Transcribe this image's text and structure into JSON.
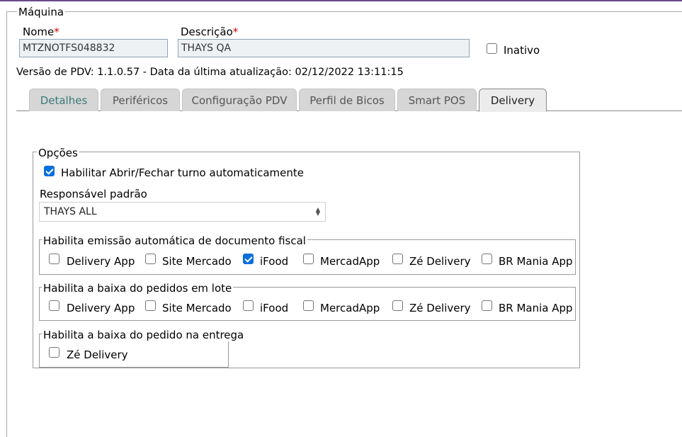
{
  "machine": {
    "legend": "Máquina",
    "nome": {
      "label": "Nome",
      "value": "MTZNOTFS048832"
    },
    "descricao": {
      "label": "Descrição",
      "value": "THAYS QA"
    },
    "inativo_label": "Inativo",
    "version_info": "Versão de PDV: 1.1.0.57 - Data da última atualização: 02/12/2022 13:11:15"
  },
  "tabs": [
    "Detalhes",
    "Periféricos",
    "Configuração PDV",
    "Perfil de Bicos",
    "Smart POS",
    "Delivery"
  ],
  "active_tab": "Delivery",
  "opcoes": {
    "legend": "Opções",
    "auto_turno_label": "Habilitar Abrir/Fechar turno automaticamente",
    "auto_turno_checked": true,
    "responsavel_label": "Responsável padrão",
    "responsavel_value": "THAYS ALL"
  },
  "emissao": {
    "legend": "Habilita emissão automática de documento fiscal",
    "items": [
      {
        "label": "Delivery App",
        "checked": false
      },
      {
        "label": "Site Mercado",
        "checked": false
      },
      {
        "label": "iFood",
        "checked": true
      },
      {
        "label": "MercadApp",
        "checked": false
      },
      {
        "label": "Zé Delivery",
        "checked": false
      },
      {
        "label": "BR Mania App",
        "checked": false
      }
    ]
  },
  "lote": {
    "legend": "Habilita a baixa do pedidos em lote",
    "items": [
      {
        "label": "Delivery App",
        "checked": false
      },
      {
        "label": "Site Mercado",
        "checked": false
      },
      {
        "label": "iFood",
        "checked": false
      },
      {
        "label": "MercadApp",
        "checked": false
      },
      {
        "label": "Zé Delivery",
        "checked": false
      },
      {
        "label": "BR Mania App",
        "checked": false
      }
    ]
  },
  "entrega": {
    "legend": "Habilita a baixa do pedido na entrega",
    "items": [
      {
        "label": "Zé Delivery",
        "checked": false
      }
    ]
  },
  "colors": {
    "accent_check": "#0a6fdb",
    "required_star": "#d20000",
    "tab_first_text": "#3a7a78"
  }
}
